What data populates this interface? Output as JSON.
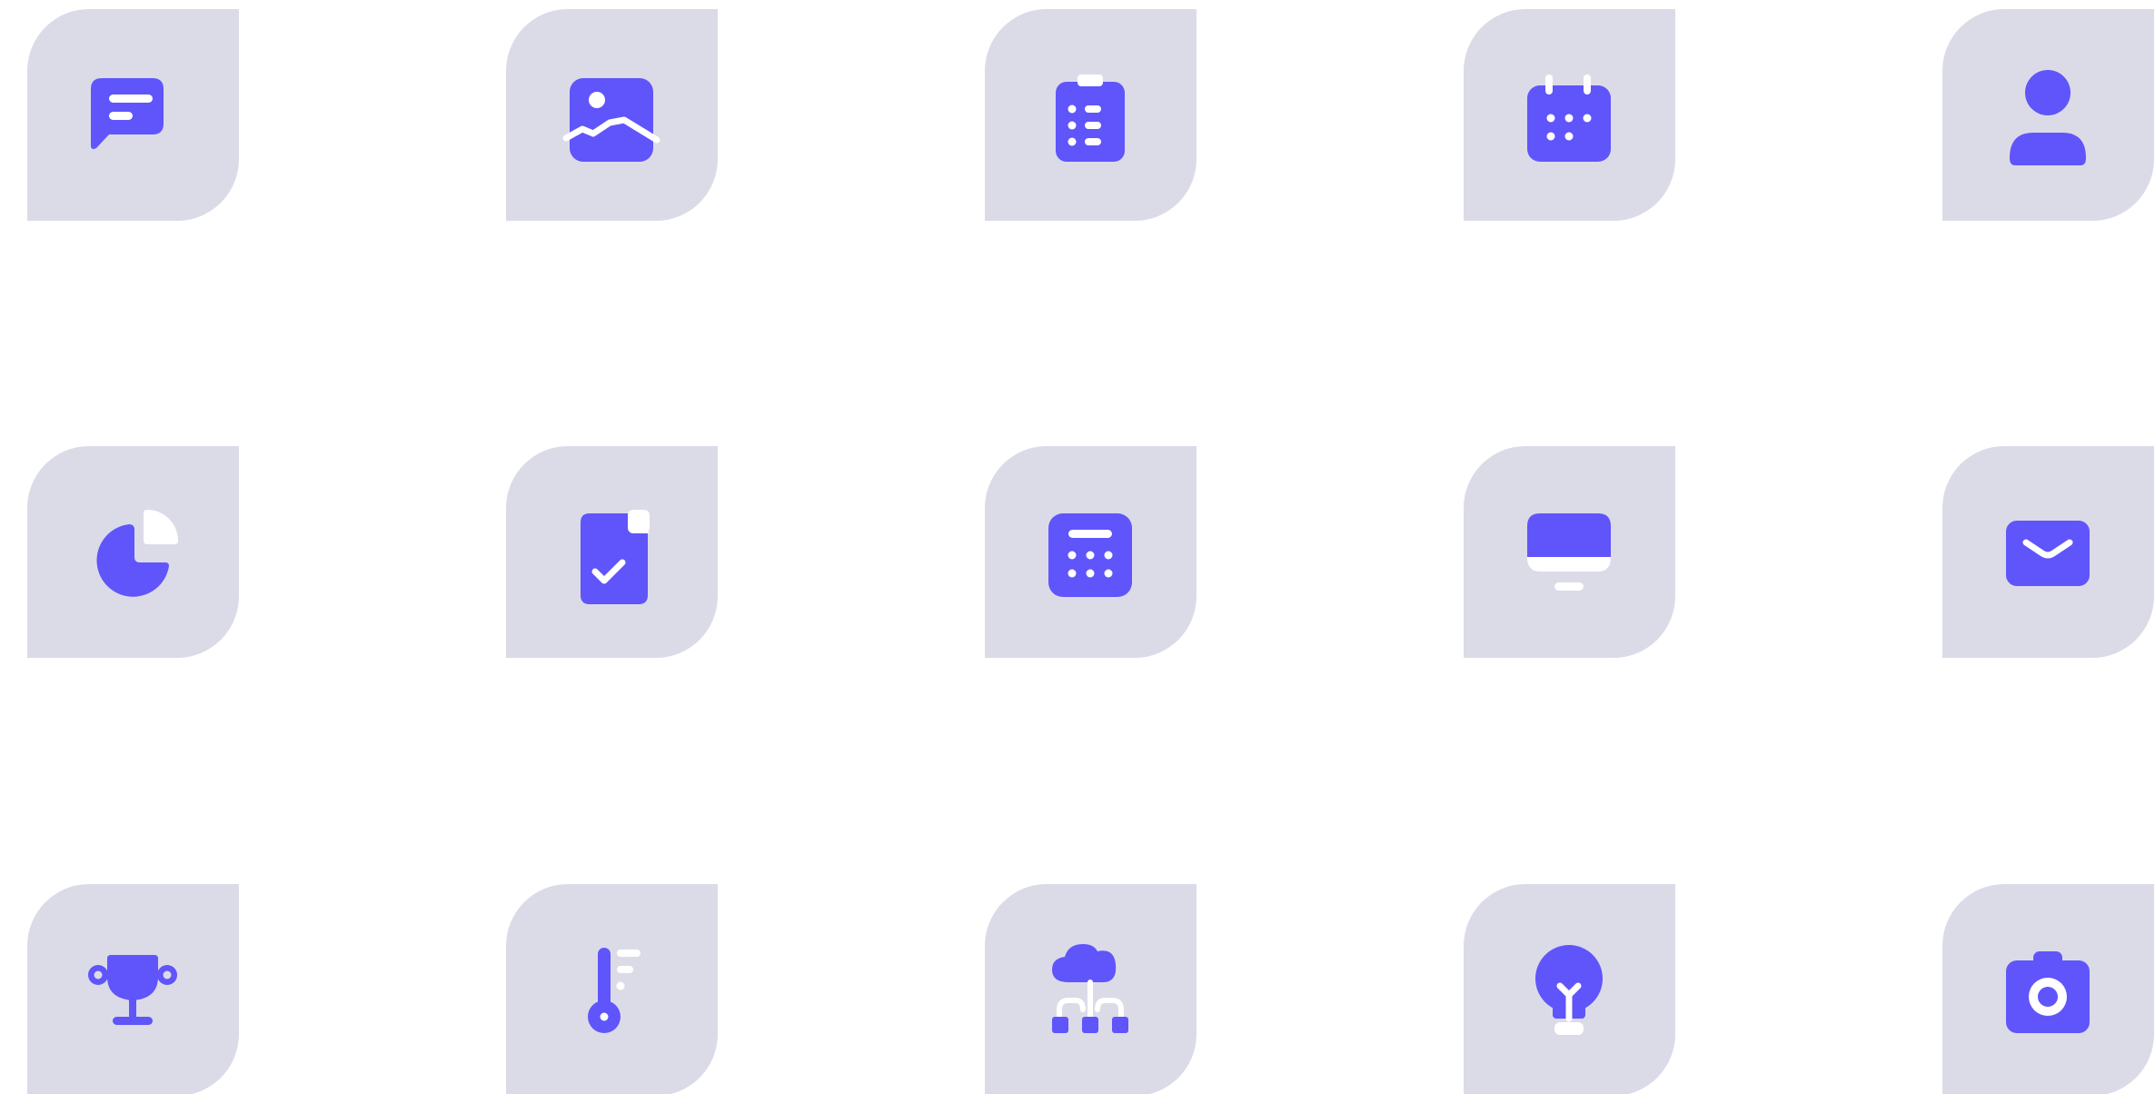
{
  "colors": {
    "tile_background": "#dbdbe8",
    "icon_primary": "#5f55fb",
    "icon_secondary": "#ffffff",
    "page_background": "#ffffff"
  },
  "icons": [
    {
      "name": "message-icon"
    },
    {
      "name": "image-icon"
    },
    {
      "name": "clipboard-icon"
    },
    {
      "name": "calendar-icon"
    },
    {
      "name": "user-icon"
    },
    {
      "name": "pie-chart-icon"
    },
    {
      "name": "document-check-icon"
    },
    {
      "name": "calculator-icon"
    },
    {
      "name": "monitor-icon"
    },
    {
      "name": "mail-icon"
    },
    {
      "name": "trophy-icon"
    },
    {
      "name": "thermometer-icon"
    },
    {
      "name": "cloud-network-icon"
    },
    {
      "name": "lightbulb-icon"
    },
    {
      "name": "camera-icon"
    }
  ]
}
